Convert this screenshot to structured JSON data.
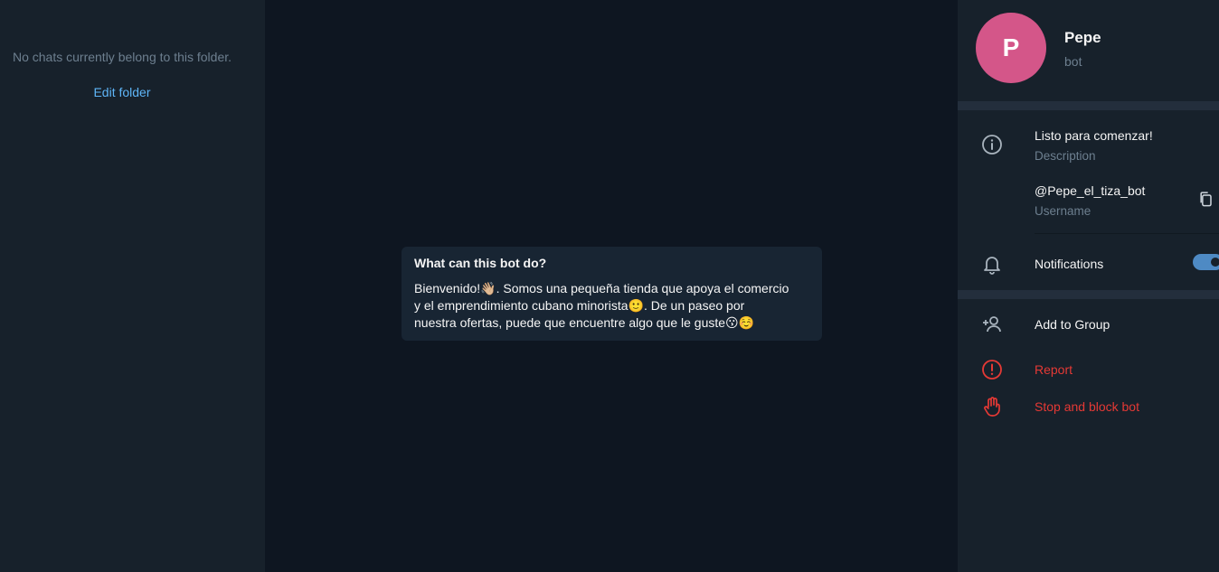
{
  "chat_list": {
    "empty_text": "No chats currently belong to this folder.",
    "edit_folder_link": "Edit folder"
  },
  "chat": {
    "card_title": "What can this bot do?",
    "card_text_line1": "Bienvenido!👋🏼. Somos una pequeña tienda que apoya el comercio",
    "card_text_line2": "y el emprendimiento cubano minorista🙂.  De un paseo por",
    "card_text_line3": "nuestra ofertas, puede que encuentre algo que le guste😗☺️"
  },
  "profile": {
    "avatar_letter": "P",
    "avatar_color": "#d45689",
    "name": "Pepe",
    "status": "bot",
    "description_value": "Listo para comenzar!",
    "description_label": "Description",
    "username_value": "@Pepe_el_tiza_bot",
    "username_label": "Username",
    "notifications_label": "Notifications",
    "notifications_enabled": true,
    "add_to_group_label": "Add to Group",
    "report_label": "Report",
    "stop_block_label": "Stop and block bot",
    "danger_color": "#e53935",
    "accent_color": "#5eb5f7"
  },
  "icons": {
    "info": "info-icon",
    "copy": "copy-icon",
    "bell": "bell-icon",
    "add_user": "add-user-icon",
    "report": "alert-circle-icon",
    "stop": "hand-stop-icon"
  }
}
